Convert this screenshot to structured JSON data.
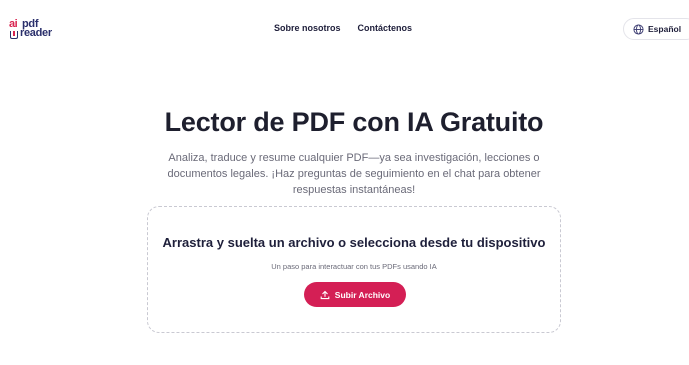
{
  "logo": {
    "ai": "ai",
    "pdf": "pdf",
    "reader": "reader"
  },
  "nav": {
    "about": "Sobre nosotros",
    "contact": "Contáctenos"
  },
  "language": {
    "selected": "Español",
    "icon": "globe-icon"
  },
  "hero": {
    "title": "Lector de PDF con IA Gratuito",
    "subtitle": "Analiza, traduce y resume cualquier PDF—ya sea investigación, lecciones o documentos legales. ¡Haz preguntas de seguimiento en el chat para obtener respuestas instantáneas!"
  },
  "dropzone": {
    "title": "Arrastra y suelta un archivo o selecciona desde tu dispositivo",
    "subtitle": "Un paso para interactuar con tus PDFs usando IA",
    "button_label": "Subir Archivo",
    "button_icon": "upload-icon"
  },
  "colors": {
    "brand": "#d41f55",
    "navy": "#2a2f6b",
    "text": "#1e1f2e",
    "muted": "#6a6a78"
  }
}
